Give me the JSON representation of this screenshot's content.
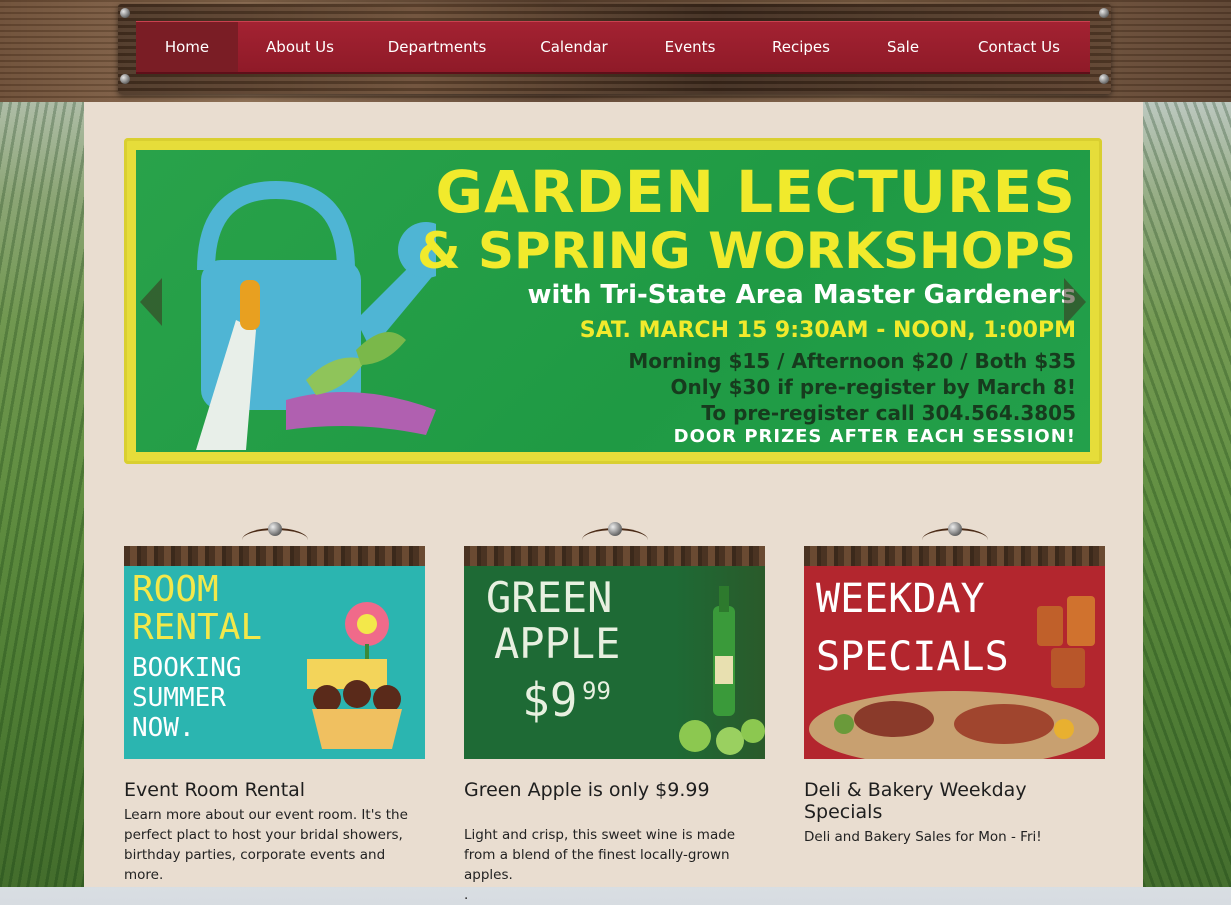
{
  "nav": {
    "items": [
      "Home",
      "About Us",
      "Departments",
      "Calendar",
      "Events",
      "Recipes",
      "Sale",
      "Contact Us"
    ],
    "active": "Home"
  },
  "banner": {
    "line1": "GARDEN LECTURES",
    "line2": "& SPRING WORKSHOPS",
    "line3": "with Tri-State Area Master Gardeners",
    "line4": "SAT. MARCH 15 9:30AM - NOON, 1:00PM",
    "line5": "Morning $15 / Afternoon $20 / Both $35",
    "line6": "Only $30 if pre-register by March 8!",
    "line7": "To pre-register call 304.564.3805",
    "line8": "DOOR PRIZES AFTER EACH SESSION!"
  },
  "cards": [
    {
      "image_lines": [
        "ROOM",
        "RENTAL",
        "BOOKING",
        "SUMMER",
        "NOW."
      ],
      "title": "Event Room Rental",
      "text": "Learn more about our event room. It's the perfect plact to host your bridal showers, birthday parties, corporate events and more."
    },
    {
      "image_lines": [
        "GREEN",
        "APPLE",
        "$9",
        "99"
      ],
      "title": "Green Apple is only $9.99",
      "text": "Light and crisp, this sweet wine is made from a blend of the finest locally-grown apples.",
      "extra": "."
    },
    {
      "image_lines": [
        "WEEKDAY",
        "SPECIALS"
      ],
      "title": "Deli & Bakery Weekday Specials",
      "text": "Deli and Bakery Sales for Mon - Fri!"
    }
  ],
  "colors": {
    "nav_red": "#a32232",
    "nav_active": "#7a1d25",
    "panel_bg": "#e9ddd0",
    "banner_green": "#29a24a",
    "banner_yellow": "#f1ea2c"
  }
}
